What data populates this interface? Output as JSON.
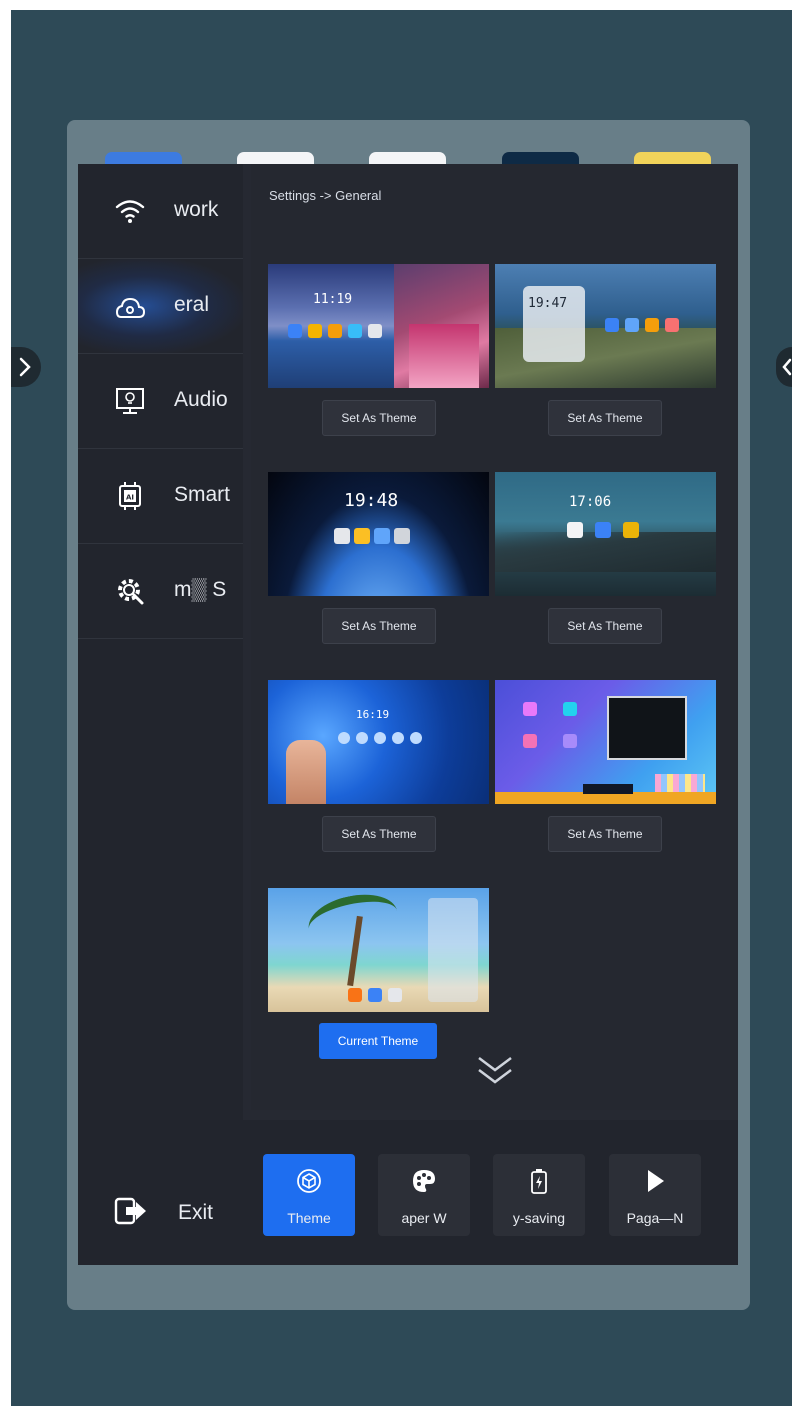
{
  "sidebar": {
    "items": [
      {
        "label": "work",
        "icon": "wifi-icon"
      },
      {
        "label": "eral",
        "icon": "cloud-settings-icon"
      },
      {
        "label": "Audio",
        "icon": "monitor-bulb-icon"
      },
      {
        "label": "Smart",
        "icon": "ai-chip-icon"
      },
      {
        "label": "m▒ S",
        "icon": "gear-wrench-icon"
      }
    ],
    "exit_label": "Exit"
  },
  "content": {
    "breadcrumb": "Settings -> General",
    "themes": [
      {
        "clock": "11:19",
        "button": "Set As Theme"
      },
      {
        "clock": "19:47",
        "button": "Set As Theme"
      },
      {
        "clock": "19:48",
        "button": "Set As Theme"
      },
      {
        "clock": "17:06",
        "button": "Set As Theme"
      },
      {
        "clock": "16:19",
        "button": "Set As Theme"
      },
      {
        "clock": "",
        "button": "Set As Theme"
      },
      {
        "clock": "",
        "button": "Current Theme"
      }
    ]
  },
  "bottom_tabs": [
    {
      "label": "Theme",
      "icon": "cube-icon",
      "active": true
    },
    {
      "label": "aper   W",
      "icon": "palette-icon",
      "active": false
    },
    {
      "label": "y-saving",
      "icon": "battery-icon",
      "active": false
    },
    {
      "label": "Paga—N",
      "icon": "play-icon",
      "active": false
    }
  ],
  "colors": {
    "accent": "#1e6ef0",
    "backdrop": "#2e4a57",
    "panel": "#252830",
    "sidebar": "#22252d"
  }
}
